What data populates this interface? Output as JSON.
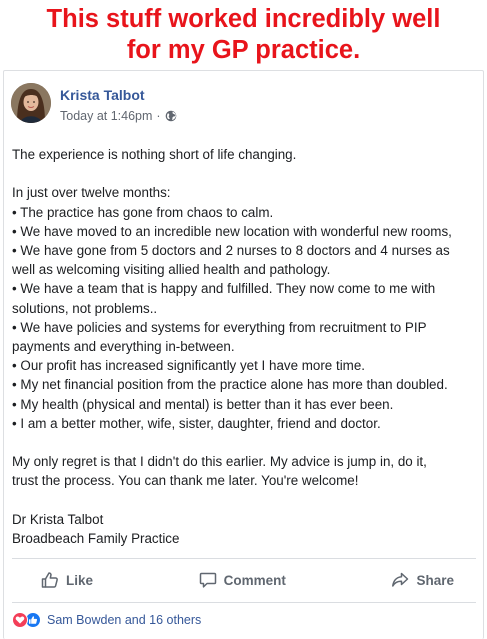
{
  "banner": {
    "line1": "This stuff worked incredibly well",
    "line2": "for my GP practice."
  },
  "post": {
    "author": "Krista Talbot",
    "timestamp": "Today at 1:46pm",
    "separator": "·",
    "privacy_icon": "globe-icon",
    "paragraph1": "The experience is nothing short of life changing.",
    "intro": "In just over twelve months:",
    "bullets": [
      "• The practice has gone from chaos to calm.",
      "• We have moved to an incredible new location with wonderful new rooms,",
      "• We have gone from 5 doctors and 2 nurses to 8 doctors and 4 nurses as",
      "well as welcoming visiting allied health and pathology.",
      "• We have a team that is happy and fulfilled. They now come to me with",
      "solutions, not problems..",
      "• We have policies and systems for everything from recruitment to PIP",
      "payments and everything in-between.",
      "• Our profit has increased significantly yet I have more time.",
      "• My net financial position from the practice alone has more than doubled.",
      "• My health (physical and mental) is better than it has ever been.",
      "• I am a better mother, wife, sister, daughter, friend and doctor."
    ],
    "closing_lines": [
      "My only regret is that I didn't do this earlier. My advice is jump in, do it,",
      "trust the process. You can thank me later. You're welcome!"
    ],
    "signature_lines": [
      "Dr Krista Talbot",
      "Broadbeach Family Practice"
    ]
  },
  "actions": {
    "like": "Like",
    "comment": "Comment",
    "share": "Share"
  },
  "reactions": {
    "icons": [
      "love-icon",
      "like-icon"
    ],
    "summary": "Sam Bowden and 16 others"
  },
  "colors": {
    "banner": "#e8141b",
    "link": "#365899",
    "muted": "#616770",
    "like_blue": "#1877f2",
    "love_red": "#f33e58"
  }
}
